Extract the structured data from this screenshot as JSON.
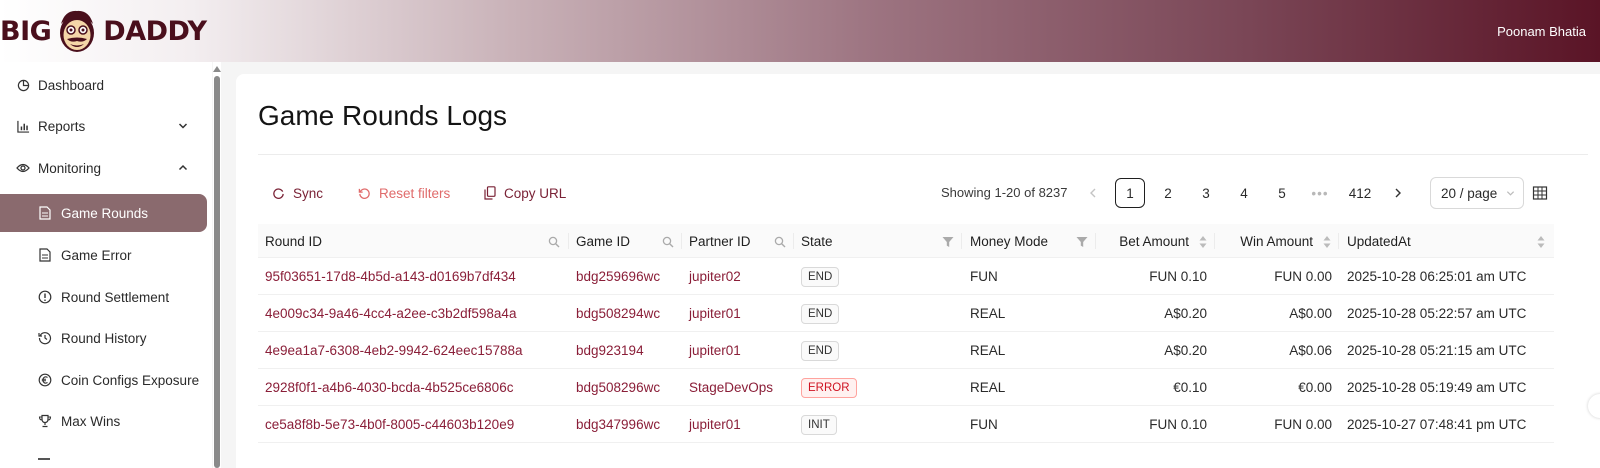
{
  "header": {
    "logo_left": "BIG",
    "logo_right": "DADDY",
    "user_name": "Poonam Bhatia"
  },
  "sidebar": {
    "items": [
      {
        "label": "Dashboard",
        "icon": "dashboard-icon"
      },
      {
        "label": "Reports",
        "icon": "bar-chart-icon",
        "expandable": true,
        "expanded": false
      },
      {
        "label": "Monitoring",
        "icon": "eye-icon",
        "expandable": true,
        "expanded": true
      },
      {
        "label": "Game Rounds",
        "icon": "file-icon",
        "active": true
      },
      {
        "label": "Game Error",
        "icon": "file-icon"
      },
      {
        "label": "Round Settlement",
        "icon": "exclamation-circle-icon"
      },
      {
        "label": "Round History",
        "icon": "history-icon"
      },
      {
        "label": "Coin Configs Exposure",
        "icon": "euro-circle-icon"
      },
      {
        "label": "Max Wins",
        "icon": "trophy-icon"
      }
    ]
  },
  "page": {
    "title": "Game Rounds Logs"
  },
  "toolbar": {
    "sync_label": "Sync",
    "reset_label": "Reset filters",
    "copy_label": "Copy URL"
  },
  "pagination": {
    "showing": "Showing 1-20 of 8237",
    "pages": [
      "1",
      "2",
      "3",
      "4",
      "5"
    ],
    "ellipsis": "•••",
    "last_page": "412",
    "current": "1",
    "page_size": "20 / page"
  },
  "table": {
    "columns": [
      "Round ID",
      "Game ID",
      "Partner ID",
      "State",
      "Money Mode",
      "Bet Amount",
      "Win Amount",
      "UpdatedAt"
    ],
    "rows": [
      {
        "round_id": "95f03651-17d8-4b5d-a143-d0169b7df434",
        "game_id": "bdg259696wc",
        "partner_id": "jupiter02",
        "state": "END",
        "money_mode": "FUN",
        "bet": "FUN 0.10",
        "win": "FUN 0.00",
        "updated": "2025-10-28 06:25:01 am UTC"
      },
      {
        "round_id": "4e009c34-9a46-4cc4-a2ee-c3b2df598a4a",
        "game_id": "bdg508294wc",
        "partner_id": "jupiter01",
        "state": "END",
        "money_mode": "REAL",
        "bet": "A$0.20",
        "win": "A$0.00",
        "updated": "2025-10-28 05:22:57 am UTC"
      },
      {
        "round_id": "4e9ea1a7-6308-4eb2-9942-624eec15788a",
        "game_id": "bdg923194",
        "partner_id": "jupiter01",
        "state": "END",
        "money_mode": "REAL",
        "bet": "A$0.20",
        "win": "A$0.06",
        "updated": "2025-10-28 05:21:15 am UTC"
      },
      {
        "round_id": "2928f0f1-a4b6-4030-bcda-4b525ce6806c",
        "game_id": "bdg508296wc",
        "partner_id": "StageDevOps",
        "state": "ERROR",
        "money_mode": "REAL",
        "bet": "€0.10",
        "win": "€0.00",
        "updated": "2025-10-28 05:19:49 am UTC"
      },
      {
        "round_id": "ce5a8f8b-5e73-4b0f-8005-c44603b120e9",
        "game_id": "bdg347996wc",
        "partner_id": "jupiter01",
        "state": "INIT",
        "money_mode": "FUN",
        "bet": "FUN 0.10",
        "win": "FUN 0.00",
        "updated": "2025-10-27 07:48:41 pm UTC"
      }
    ]
  },
  "colors": {
    "brand": "#5a1426",
    "link": "#8a1e38",
    "active_nav": "#8a6a6e",
    "reset": "#e06b6b"
  }
}
